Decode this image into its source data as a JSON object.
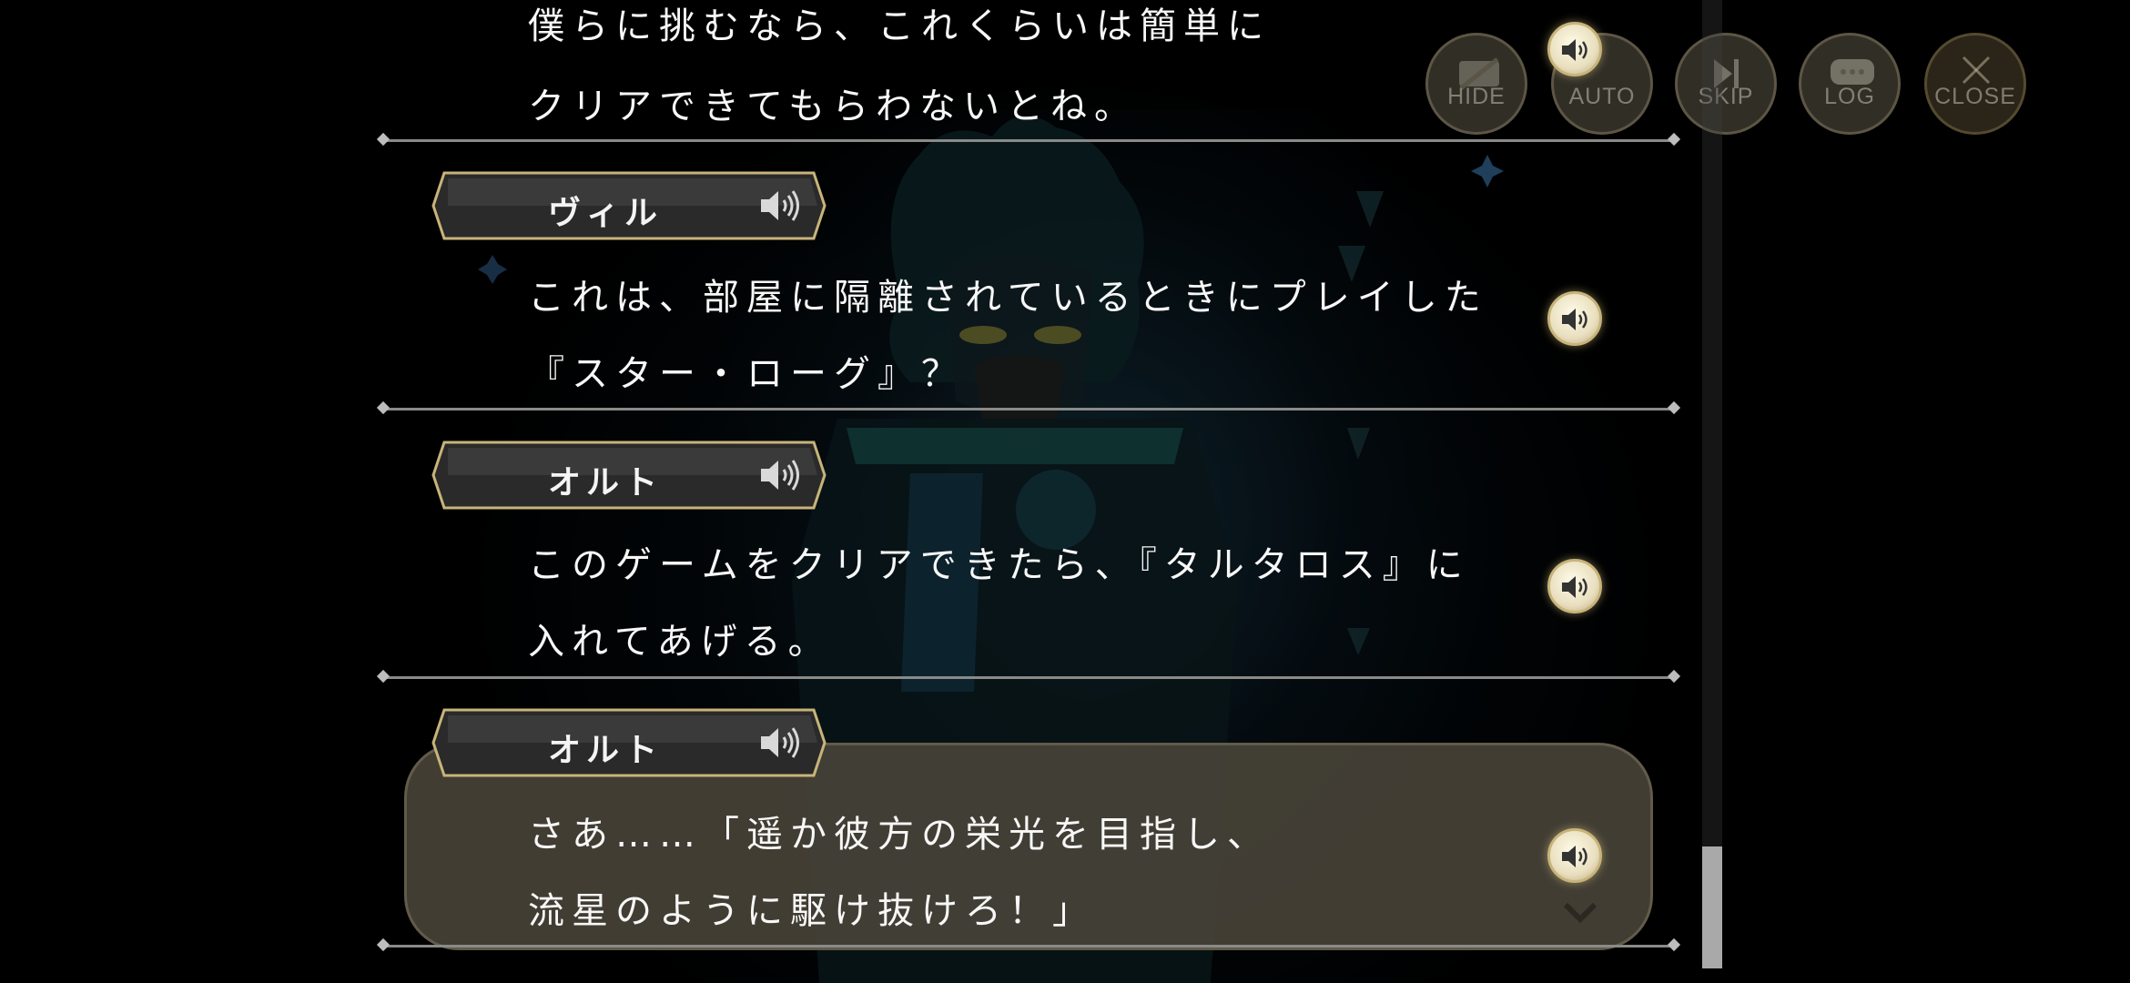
{
  "controls": [
    {
      "id": "hide",
      "label": "HIDE"
    },
    {
      "id": "auto",
      "label": "AUTO"
    },
    {
      "id": "skip",
      "label": "SKIP"
    },
    {
      "id": "log",
      "label": "LOG"
    },
    {
      "id": "close",
      "label": "CLOSE"
    }
  ],
  "log_entries": [
    {
      "speaker": "",
      "lines": [
        "僕らに挑むなら、これくらいは簡単に",
        "クリアできてもらわないとね。"
      ]
    },
    {
      "speaker": "ヴィル",
      "lines": [
        "これは、部屋に隔離されているときにプレイした",
        "『スター・ローグ』？"
      ]
    },
    {
      "speaker": "オルト",
      "lines": [
        "このゲームをクリアできたら、『タルタロス』に",
        "入れてあげる。"
      ]
    },
    {
      "speaker": "オルト",
      "lines": [
        "さあ……「遥か彼方の栄光を目指し、",
        "流星のように駆け抜けろ！」"
      ]
    }
  ],
  "icons": {
    "speaker": "speaker-icon",
    "voice": "voice-play-icon",
    "chevron": "chevron-down-icon"
  },
  "colors": {
    "nameplate_border": "#c8b47a",
    "voice_button": "#efe6c9",
    "bubble": "#4a463a"
  }
}
